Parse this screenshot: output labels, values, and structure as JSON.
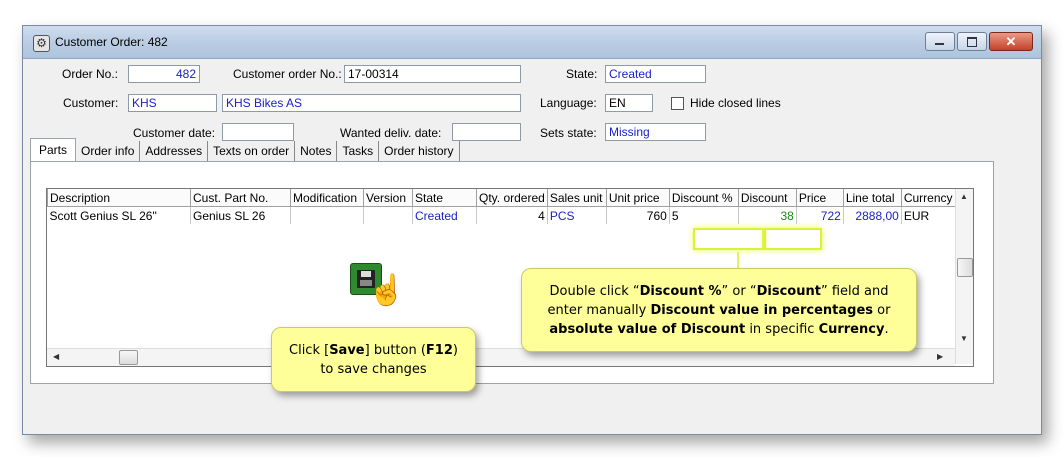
{
  "window": {
    "title": "Customer Order: 482",
    "buttons": {
      "close_glyph": "✕"
    }
  },
  "header": {
    "order_no_label": "Order No.:",
    "order_no": "482",
    "customer_order_no_label": "Customer order No.:",
    "customer_order_no": "17-00314",
    "state_label": "State:",
    "state": "Created",
    "customer_label": "Customer:",
    "customer_code": "KHS",
    "customer_name": "KHS Bikes AS",
    "language_label": "Language:",
    "language": "EN",
    "hide_closed_label": "Hide closed lines",
    "hide_closed_checked": false,
    "customer_date_label": "Customer date:",
    "customer_date": "",
    "wanted_date_label": "Wanted deliv. date:",
    "wanted_date": "",
    "sets_state_label": "Sets state:",
    "sets_state": "Missing"
  },
  "tabs": [
    {
      "label": "Parts",
      "active": true
    },
    {
      "label": "Order info"
    },
    {
      "label": "Addresses"
    },
    {
      "label": "Texts on order"
    },
    {
      "label": "Notes"
    },
    {
      "label": "Tasks"
    },
    {
      "label": "Order history"
    }
  ],
  "grid": {
    "columns": [
      "Description",
      "Cust. Part No.",
      "Modification",
      "Version",
      "State",
      "Qty. ordered",
      "Sales unit",
      "Unit price",
      "Discount %",
      "Discount",
      "Price",
      "Line total",
      "Currency"
    ],
    "rows": [
      {
        "description": "Scott Genius SL 26\"",
        "cust_part_no": "Genius SL 26",
        "modification": "",
        "version": "",
        "state": "Created",
        "qty_ordered": "4",
        "sales_unit": "PCS",
        "unit_price": "760",
        "discount_pct": "5",
        "discount": "38",
        "price": "722",
        "line_total": "2888,00",
        "currency": "EUR"
      }
    ]
  },
  "callouts": {
    "save": {
      "l1_pre": "Click [",
      "l1_bold": "Save",
      "l1_mid": "] button (",
      "l1_bold2": "F12",
      "l1_post": ")",
      "l2": "to save changes"
    },
    "discount": {
      "l1_a": "Double click “",
      "l1_b": "Discount %",
      "l1_c": "” or “",
      "l1_d": "Discount",
      "l1_e": "” field and",
      "l2_a": "enter manually ",
      "l2_b": "Discount value in percentages",
      "l2_c": " or",
      "l3_a": "absolute value of Discount",
      "l3_b": " in specific ",
      "l3_c": "Currency",
      "l3_d": "."
    }
  },
  "colors": {
    "link_blue": "#1a22c8",
    "discount_green": "#1a8a1a",
    "callout_bg": "#ffff99",
    "highlight": "#d9f23a"
  }
}
